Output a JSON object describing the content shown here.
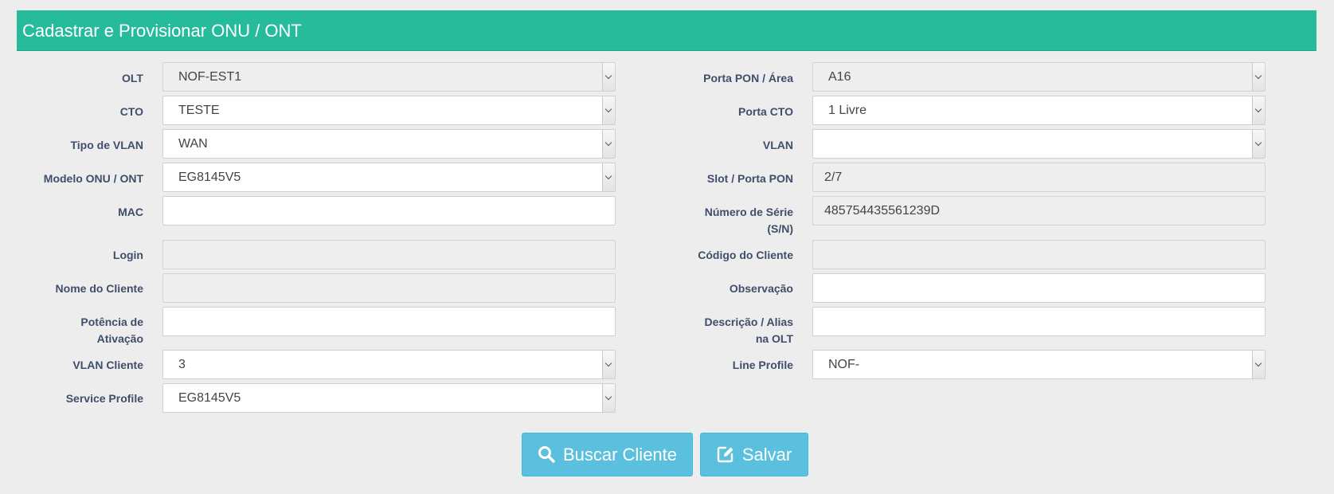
{
  "header": {
    "title": "Cadastrar e Provisionar ONU / ONT"
  },
  "left": {
    "olt": {
      "label": "OLT",
      "value": "NOF-EST1"
    },
    "cto": {
      "label": "CTO",
      "value": "TESTE"
    },
    "tipo_vlan": {
      "label": "Tipo de VLAN",
      "value": "WAN"
    },
    "modelo": {
      "label": "Modelo ONU / ONT",
      "value": "EG8145V5"
    },
    "mac": {
      "label": "MAC",
      "value": ""
    },
    "login": {
      "label": "Login",
      "value": ""
    },
    "nome_cliente": {
      "label": "Nome do Cliente",
      "value": ""
    },
    "potencia": {
      "label_line1": "Potência de",
      "label_line2": "Ativação",
      "value": ""
    },
    "vlan_cliente": {
      "label": "VLAN Cliente",
      "value": "3"
    },
    "service_profile": {
      "label": "Service Profile",
      "value": "EG8145V5"
    }
  },
  "right": {
    "porta_pon": {
      "label": "Porta PON / Área",
      "value": "A16"
    },
    "porta_cto": {
      "label": "Porta CTO",
      "value": "1 Livre"
    },
    "vlan": {
      "label": "VLAN",
      "value": ""
    },
    "slot_porta": {
      "label": "Slot / Porta PON",
      "value": "2/7"
    },
    "numero_serie": {
      "label_line1": "Número de Série",
      "label_line2": "(S/N)",
      "value": "485754435561239D"
    },
    "codigo_cliente": {
      "label": "Código do Cliente",
      "value": ""
    },
    "observacao": {
      "label": "Observação",
      "value": ""
    },
    "descricao": {
      "label_line1": "Descrição / Alias",
      "label_line2": "na OLT",
      "value": ""
    },
    "line_profile": {
      "label": "Line Profile",
      "value": "NOF-"
    }
  },
  "buttons": {
    "buscar": {
      "label": "Buscar Cliente",
      "icon": "search-icon"
    },
    "salvar": {
      "label": "Salvar",
      "icon": "edit-icon"
    }
  },
  "colors": {
    "header": "#26bb9b",
    "button": "#5bc0de",
    "label": "#3e4e6b"
  }
}
